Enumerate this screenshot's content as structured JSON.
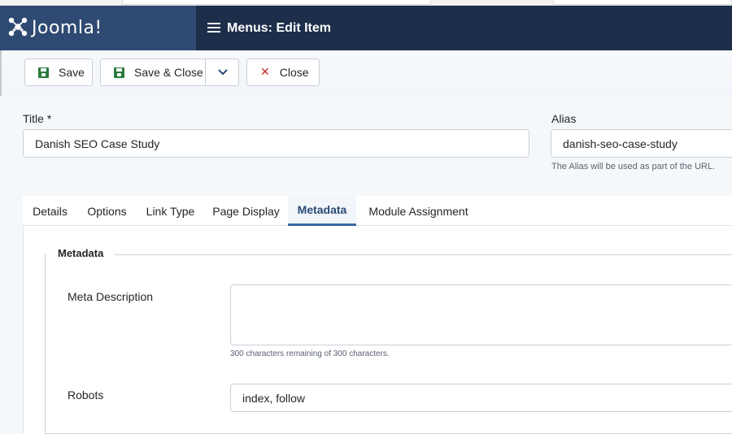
{
  "brand": {
    "name": "Joomla!"
  },
  "header": {
    "title": "Menus: Edit Item",
    "title_icon": "list-icon"
  },
  "toolbar": {
    "save_label": "Save",
    "save_close_label": "Save & Close",
    "close_label": "Close",
    "dropdown_icon": "chevron-down-icon"
  },
  "form": {
    "title_label": "Title *",
    "title_value": "Danish SEO Case Study",
    "alias_label": "Alias",
    "alias_value": "danish-seo-case-study",
    "alias_hint": "The Alias will be used as part of the URL."
  },
  "tabs": [
    {
      "label": "Details"
    },
    {
      "label": "Options"
    },
    {
      "label": "Link Type"
    },
    {
      "label": "Page Display"
    },
    {
      "label": "Metadata",
      "active": true
    },
    {
      "label": "Module Assignment"
    }
  ],
  "metadata": {
    "legend": "Metadata",
    "meta_description_label": "Meta Description",
    "meta_description_value": "",
    "meta_description_hint": "300 characters remaining of 300 characters.",
    "robots_label": "Robots",
    "robots_value": "index, follow"
  },
  "colors": {
    "header_bg": "#1c2e4a",
    "brand_bg": "#2f4a72",
    "save_green": "#2a7a3c",
    "close_red": "#c52827",
    "active_tab": "#2a4a75"
  }
}
